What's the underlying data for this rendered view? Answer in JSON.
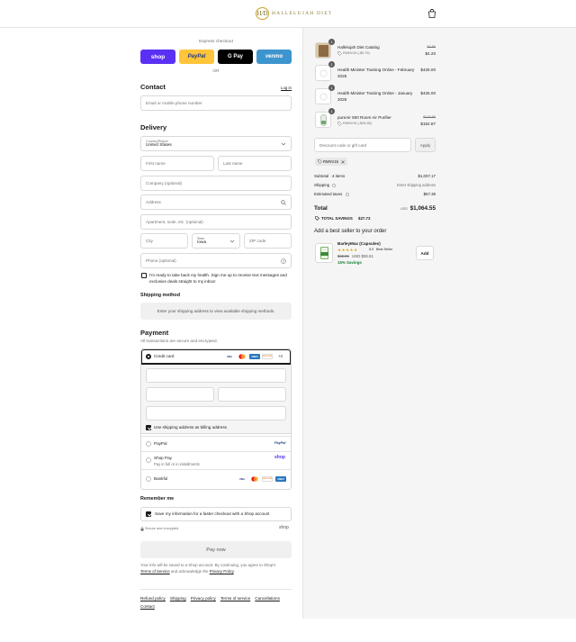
{
  "header": {
    "logo_mark": "H/D",
    "logo_text": "HALLELUJAH DIET"
  },
  "express": {
    "label": "Express checkout",
    "shop_label": "shop",
    "paypal_label": "PayPal",
    "gpay_label": "G Pay",
    "venmo_label": "venmo",
    "or_label": "OR"
  },
  "contact": {
    "title": "Contact",
    "login_label": "Log in",
    "email_placeholder": "Email or mobile phone number"
  },
  "delivery": {
    "title": "Delivery",
    "country_label": "Country/Region",
    "country_value": "United States",
    "first_name_placeholder": "First name",
    "last_name_placeholder": "Last name",
    "company_placeholder": "Company (optional)",
    "address_placeholder": "Address",
    "apartment_placeholder": "Apartment, suite, etc. (optional)",
    "city_placeholder": "City",
    "state_label": "State",
    "state_value": "Iowa",
    "zip_placeholder": "ZIP code",
    "phone_placeholder": "Phone (optional)",
    "sms_text_line1": "I'm ready to take back my health. Sign me up to receive text messages and",
    "sms_text_line2": "exclusive deals straight to my inbox!"
  },
  "shipping": {
    "title": "Shipping method",
    "placeholder": "Enter your shipping address to view available shipping methods."
  },
  "payment": {
    "title": "Payment",
    "subtitle": "All transactions are secure and encrypted.",
    "credit_card_label": "Credit card",
    "more_cards": "+4",
    "billing_same_label": "Use shipping address as billing address",
    "paypal_label": "PayPal",
    "paypal_logo": "PayPal",
    "shoppay_label": "Shop Pay",
    "shoppay_sub": "Pay in full or in installments",
    "shoppay_logo": "shop",
    "bankful_label": "Bankful",
    "card_visa": "VISA",
    "card_amex": "AMEX",
    "card_discover": "DISCOVER"
  },
  "remember": {
    "title": "Remember me",
    "save_label": "Save my information for a faster checkout with a Shop account",
    "secure_label": "Secure and encrypted",
    "shop_logo": "shop"
  },
  "pay_now_label": "Pay now",
  "legal": {
    "line1": "Your info will be saved to a Shop account. By continuing, you agree to Shop's",
    "terms_link": "Terms of Service",
    "and_text": "and acknowledge the",
    "privacy_link": "Privacy Policy"
  },
  "footer_links": [
    "Refund policy",
    "Shipping",
    "Privacy policy",
    "Terms of service",
    "Cancellations",
    "Contact"
  ],
  "cart": {
    "items": [
      {
        "name": "Hallelujah Diet Catalog",
        "qty": "1",
        "discount": "RMNV15 (-$0.75)",
        "original_price": "$4.95",
        "price": "$4.20"
      },
      {
        "name": "Health Minister Training Online - February 2025",
        "qty": "1",
        "price": "$425.00"
      },
      {
        "name": "Health Minister Training Online - January 2025",
        "qty": "1",
        "price": "$425.00"
      },
      {
        "name": "pureAir 500 Room Air Purifier",
        "qty": "1",
        "discount": "RMNV15 (-$26.98)",
        "original_price": "$179.85",
        "price": "$152.87"
      }
    ],
    "discount_placeholder": "Discount code or gift card",
    "apply_label": "Apply",
    "applied_code": "RMNV15",
    "subtotal_label": "Subtotal · 4 items",
    "subtotal_value": "$1,007.17",
    "shipping_label": "Shipping",
    "shipping_value": "Enter shipping address",
    "taxes_label": "Estimated taxes",
    "taxes_value": "$57.38",
    "total_label": "Total",
    "total_currency": "USD",
    "total_value": "$1,064.55",
    "savings_label": "TOTAL SAVINGS",
    "savings_value": "$27.73",
    "bestseller_title": "Add a best seller to your order",
    "bestseller": {
      "name": "BarleyMax (Capsules)",
      "stars": "★★★★★",
      "rating": "5.0",
      "rating_label": "Best Seller",
      "original_price": "$42.95",
      "price": "USD $36.51",
      "savings": "15% Savings",
      "add_label": "Add"
    }
  },
  "colors": {
    "shop": "#5a31f4",
    "paypal": "#ffc439",
    "gpay": "#000000",
    "venmo": "#3d95ce",
    "savings_green": "#1a7f37",
    "star": "#e8a317"
  }
}
